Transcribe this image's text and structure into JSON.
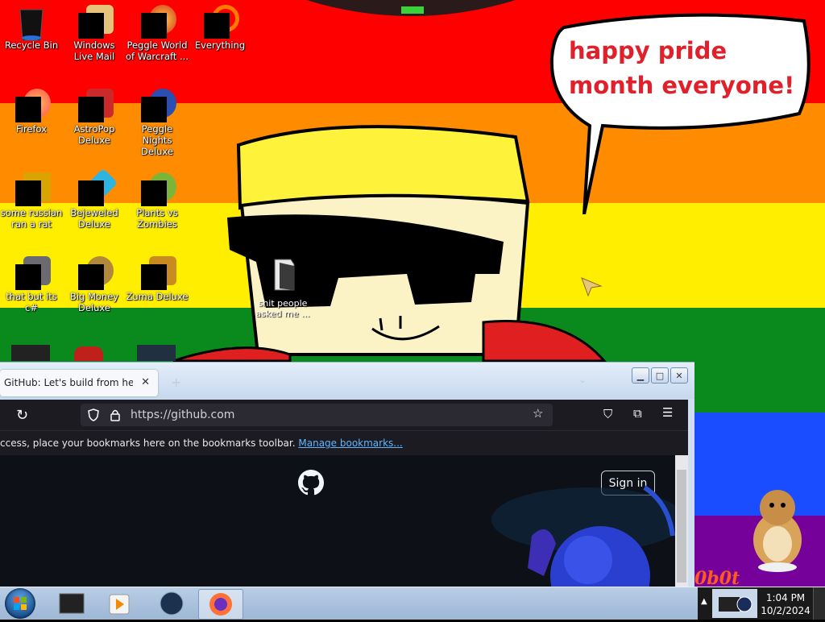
{
  "desktop": {
    "bubble_text": "happy pride month everyone!",
    "icons": [
      {
        "label": "Recycle Bin"
      },
      {
        "label": "Windows Live Mail"
      },
      {
        "label": "Peggle World of Warcraft ..."
      },
      {
        "label": "Everything"
      },
      {
        "label": "Firefox"
      },
      {
        "label": "AstroPop Deluxe"
      },
      {
        "label": "Peggle Nights Deluxe"
      },
      {
        "label": "some russian ran a rat"
      },
      {
        "label": "Bejeweled Deluxe"
      },
      {
        "label": "Plants vs Zombies"
      },
      {
        "label": "that but its c#"
      },
      {
        "label": "Big Money Deluxe"
      },
      {
        "label": "Zuma Deluxe"
      }
    ],
    "folder_label": "shit people asked me ...",
    "corner_text": "0b0t"
  },
  "browser": {
    "tab_title": "GitHub: Let's build from here · G",
    "new_tab": "+",
    "tab_close": "✕",
    "url": "https://github.com",
    "bookmarks_text": "ccess, place your bookmarks here on the bookmarks toolbar.",
    "manage_bookmarks": "Manage bookmarks...",
    "signin_label": "Sign in",
    "window_buttons": {
      "minimize": "▁",
      "maximize": "□",
      "close": "✕"
    }
  },
  "taskbar": {
    "time": "1:04 PM",
    "date": "10/2/2024"
  },
  "colors": {
    "red": "#fe0000",
    "orange": "#ff8c00",
    "yellow": "#ffee00",
    "green": "#0a8a1c",
    "blue": "#1a4dff",
    "purple": "#76009a",
    "bubble_text": "#e0202a",
    "link": "#5fb6ff"
  }
}
